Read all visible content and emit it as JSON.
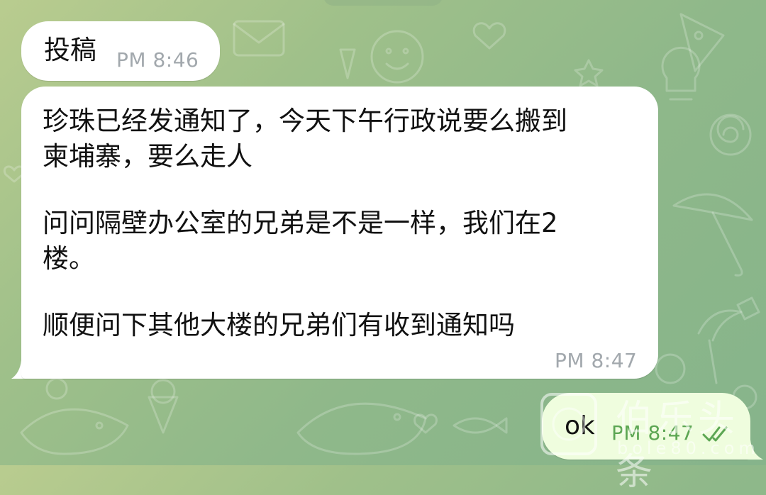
{
  "messages": [
    {
      "text": "投稿",
      "time": "PM 8:46"
    },
    {
      "paragraphs": [
        "珍珠已经发通知了，今天下午行政说要么搬到\n柬埔寨，要么走人",
        "问问隔壁办公室的兄弟是不是一样，我们在2\n楼。",
        "顺便问下其他大楼的兄弟们有收到通知吗"
      ],
      "time": "PM 8:47"
    },
    {
      "text": "ok",
      "time": "PM 8:47",
      "status_icon": "double-check-icon"
    }
  ],
  "watermark": {
    "title": "伯乐头条",
    "domain": "bole80.com"
  },
  "colors": {
    "incoming_bubble": "#ffffff",
    "outgoing_bubble": "#effdde",
    "outgoing_meta": "#5ca653",
    "incoming_meta": "#a2a8ad"
  }
}
